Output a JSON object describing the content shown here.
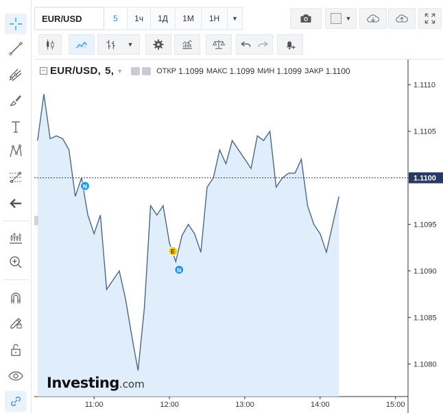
{
  "toolbar": {
    "symbol": "EUR/USD",
    "intervals": [
      "5",
      "1ч",
      "1Д",
      "1М",
      "1Н"
    ],
    "active_interval": "5"
  },
  "left_tools": [
    {
      "name": "crosshair-icon",
      "active": true
    },
    {
      "name": "trend-line-icon"
    },
    {
      "name": "pitchfork-icon"
    },
    {
      "name": "brush-icon"
    },
    {
      "name": "text-icon"
    },
    {
      "name": "pattern-icon"
    },
    {
      "name": "fib-levels-icon"
    },
    {
      "name": "back-arrow-icon"
    },
    {
      "name": "indicators-icon"
    },
    {
      "name": "zoom-in-icon"
    },
    {
      "name": "magnet-icon"
    },
    {
      "name": "lock-drawing-icon"
    },
    {
      "name": "unlock-icon"
    },
    {
      "name": "eye-icon"
    },
    {
      "name": "link-icon",
      "active": true
    }
  ],
  "legend": {
    "symbol": "EUR/USD,",
    "interval": "5,",
    "open_label": "ОТКР",
    "open": "1.1099",
    "high_label": "МАКС",
    "high": "1.1099",
    "low_label": "МИН",
    "low": "1.1099",
    "close_label": "ЗАКР",
    "close": "1.1100"
  },
  "watermark": {
    "brand": "Investing",
    "domain": ".com"
  },
  "chart_data": {
    "type": "area",
    "y_ticks": [
      "1.1110",
      "1.1105",
      "1.1100",
      "1.1095",
      "1.1090",
      "1.1085",
      "1.1080"
    ],
    "x_ticks": [
      "11:00",
      "12:00",
      "13:00",
      "14:00",
      "15:00"
    ],
    "ylim": [
      1.10765,
      1.11127
    ],
    "xlim": [
      "10:14",
      "15:10"
    ],
    "current_price": "1.1100",
    "line_color": "#4a6685",
    "fill_color": "#dbeaf9",
    "price_line_color": "#283a63",
    "x": [
      "10:15",
      "10:20",
      "10:25",
      "10:30",
      "10:35",
      "10:40",
      "10:45",
      "10:50",
      "10:55",
      "11:00",
      "11:05",
      "11:10",
      "11:15",
      "11:20",
      "11:25",
      "11:30",
      "11:35",
      "11:40",
      "11:45",
      "11:50",
      "11:55",
      "12:00",
      "12:05",
      "12:10",
      "12:15",
      "12:20",
      "12:25",
      "12:30",
      "12:35",
      "12:40",
      "12:45",
      "12:50",
      "12:55",
      "13:00",
      "13:05",
      "13:10",
      "13:15",
      "13:20",
      "13:25",
      "13:30",
      "13:35",
      "13:40",
      "13:45",
      "13:50",
      "13:55",
      "14:00",
      "14:05",
      "14:10",
      "14:15"
    ],
    "values": [
      1.1104,
      1.1109,
      1.11042,
      1.11045,
      1.11042,
      1.1103,
      1.1098,
      1.11,
      1.1096,
      1.1094,
      1.1096,
      1.1088,
      1.1089,
      1.109,
      1.1087,
      1.1083,
      1.10793,
      1.1086,
      1.1097,
      1.1096,
      1.1097,
      1.1093,
      1.1091,
      1.10938,
      1.1095,
      1.1094,
      1.1092,
      1.1099,
      1.11,
      1.1103,
      1.11015,
      1.1104,
      1.1103,
      1.1102,
      1.1101,
      1.11045,
      1.1104,
      1.1105,
      1.1099,
      1.11,
      1.11005,
      1.11005,
      1.1102,
      1.1097,
      1.1095,
      1.1094,
      1.1092,
      1.1095,
      1.1098
    ],
    "events": [
      {
        "label": "N",
        "time": "10:50",
        "color": "#2196f3"
      },
      {
        "label": "E",
        "time": "12:00",
        "color": "#f5c518"
      },
      {
        "label": "N",
        "time": "12:05",
        "color": "#2196f3"
      }
    ]
  }
}
